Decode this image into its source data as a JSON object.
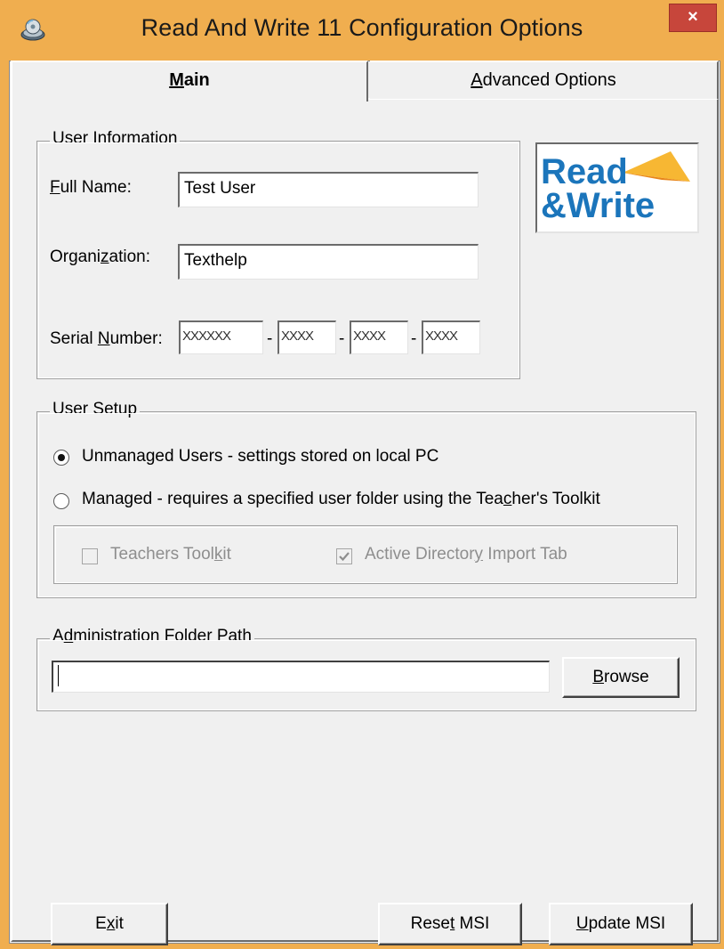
{
  "window": {
    "title": "Read And Write 11 Configuration Options",
    "close_glyph": "×",
    "accent": "#f0ae4f"
  },
  "tabs": [
    {
      "label": "Main",
      "selected": true
    },
    {
      "label": "Advanced Options",
      "selected": false
    }
  ],
  "user_information": {
    "legend": "User Information",
    "full_name_label": "Full Name:",
    "full_name_value": "Test User",
    "organization_label": "Organization:",
    "organization_value": "Texthelp",
    "serial_label": "Serial Number:",
    "serial_parts": [
      "XXXXXX",
      "XXXX",
      "XXXX",
      "XXXX"
    ],
    "serial_separator": "-"
  },
  "logo": {
    "line1": "Read",
    "line2": "&Write"
  },
  "user_setup": {
    "legend": "User Setup",
    "option_unmanaged": "Unmanaged Users - settings stored on local PC",
    "option_managed": "Managed - requires a specified user folder using the Teacher's Toolkit",
    "selected": "unmanaged",
    "teachers_toolkit_label": "Teachers Toolkit",
    "teachers_toolkit_checked": false,
    "ad_import_label": "Active Directory Import Tab",
    "ad_import_checked": true
  },
  "admin_folder": {
    "legend": "Administration Folder Path",
    "path_value": "",
    "browse_label": "Browse"
  },
  "footer": {
    "exit_label": "Exit",
    "reset_label": "Reset MSI",
    "update_label": "Update MSI"
  }
}
